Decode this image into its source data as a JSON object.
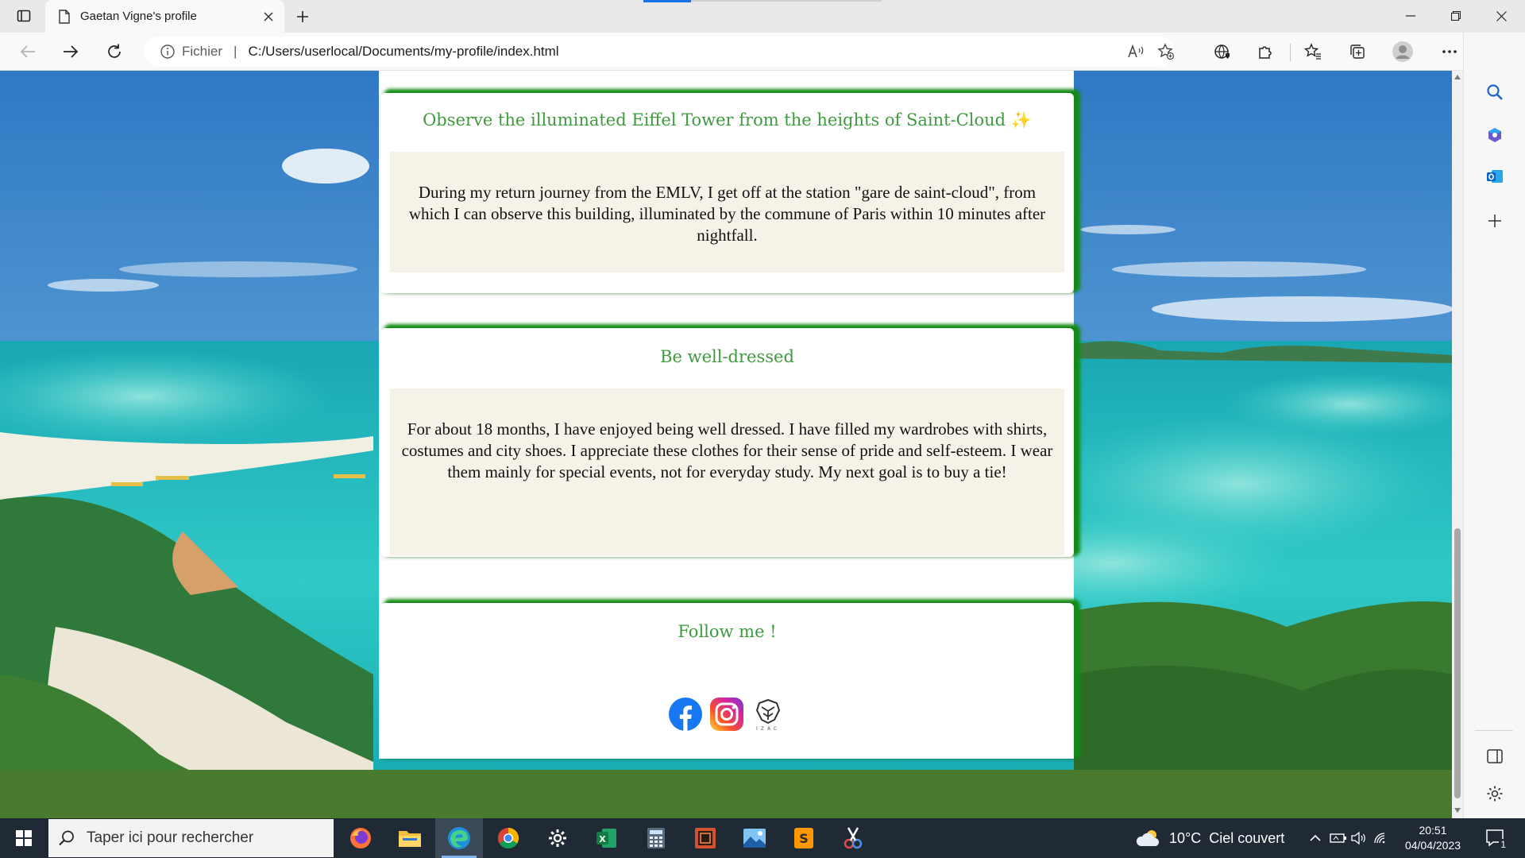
{
  "browser": {
    "tab_title": "Gaetan Vigne's profile",
    "address_scheme": "Fichier",
    "address_separator": "|",
    "address_url": "C:/Users/userlocal/Documents/my-profile/index.html"
  },
  "page": {
    "cards": [
      {
        "title": "Observe the illuminated Eiffel Tower from the heights of Saint-Cloud",
        "title_emoji": "✨",
        "body": "During my return journey from the EMLV, I get off at the station \"gare de saint-cloud\", from which I can observe this building, illuminated by the commune of Paris within 10 minutes after nightfall."
      },
      {
        "title": "Be well-dressed",
        "body": "For about 18 months, I have enjoyed being well dressed. I have filled my wardrobes with shirts, costumes and city shoes. I appreciate these clothes for their sense of pride and self-esteem. I wear them mainly for special events, not for everyday study. My next goal is to buy a tie!"
      }
    ],
    "follow": {
      "title": "Follow me !",
      "links": [
        "facebook",
        "instagram",
        "izac"
      ],
      "izac_label": "IZAC"
    }
  },
  "taskbar": {
    "search_placeholder": "Taper ici pour rechercher",
    "weather_temp": "10°C",
    "weather_desc": "Ciel couvert",
    "time": "20:51",
    "date": "04/04/2023",
    "notification_count": "1",
    "excel_letter": "X",
    "sublime_letter": "S"
  },
  "colors": {
    "accent_green": "#3e9a3e",
    "card_glow": "#138a13",
    "body_bg": "#f6f2e8"
  }
}
